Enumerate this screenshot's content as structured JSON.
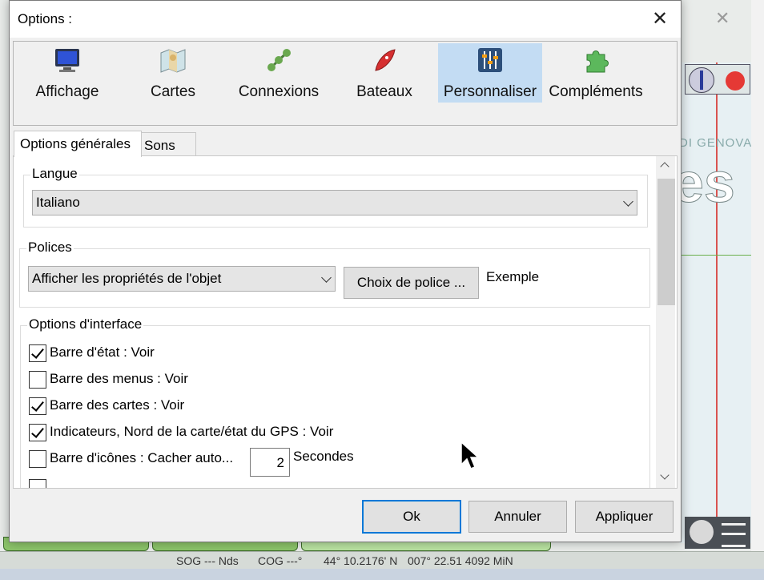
{
  "background": {
    "map_text_1": "DI GENOVA",
    "map_text_2": "es",
    "status": {
      "sog": "SOG --- Nds",
      "cog": "COG ---°",
      "lat": "44° 10.2176' N",
      "lon": "007° 22.51 4092 MiN"
    }
  },
  "dialog": {
    "title": "Options :",
    "close_icon": "close-icon",
    "categories": [
      {
        "label": "Affichage",
        "icon": "monitor-icon",
        "selected": false
      },
      {
        "label": "Cartes",
        "icon": "map-icon",
        "selected": false
      },
      {
        "label": "Connexions",
        "icon": "connections-icon",
        "selected": false
      },
      {
        "label": "Bateaux",
        "icon": "boat-icon",
        "selected": false
      },
      {
        "label": "Personnaliser",
        "icon": "sliders-icon",
        "selected": true
      },
      {
        "label": "Compléments",
        "icon": "puzzle-icon",
        "selected": false
      }
    ],
    "tabs": [
      {
        "label": "Options générales",
        "active": true
      },
      {
        "label": "Sons",
        "active": false
      }
    ],
    "langue": {
      "title": "Langue",
      "selected": "Italiano"
    },
    "polices": {
      "title": "Polices",
      "selected": "Afficher les propriétés de l'objet",
      "choose_button": "Choix de police ...",
      "sample": "Exemple"
    },
    "interface": {
      "title": "Options d'interface",
      "options": [
        {
          "label": "Barre d'état : Voir",
          "checked": true
        },
        {
          "label": "Barre des menus : Voir",
          "checked": false
        },
        {
          "label": "Barre des cartes : Voir",
          "checked": true
        },
        {
          "label": "Indicateurs, Nord de la carte/état du GPS : Voir",
          "checked": true
        },
        {
          "label": "Barre d'icônes : Cacher auto...",
          "checked": false
        }
      ],
      "autohide_seconds": "2",
      "seconds_label": "Secondes"
    },
    "buttons": {
      "ok": "Ok",
      "cancel": "Annuler",
      "apply": "Appliquer"
    }
  }
}
